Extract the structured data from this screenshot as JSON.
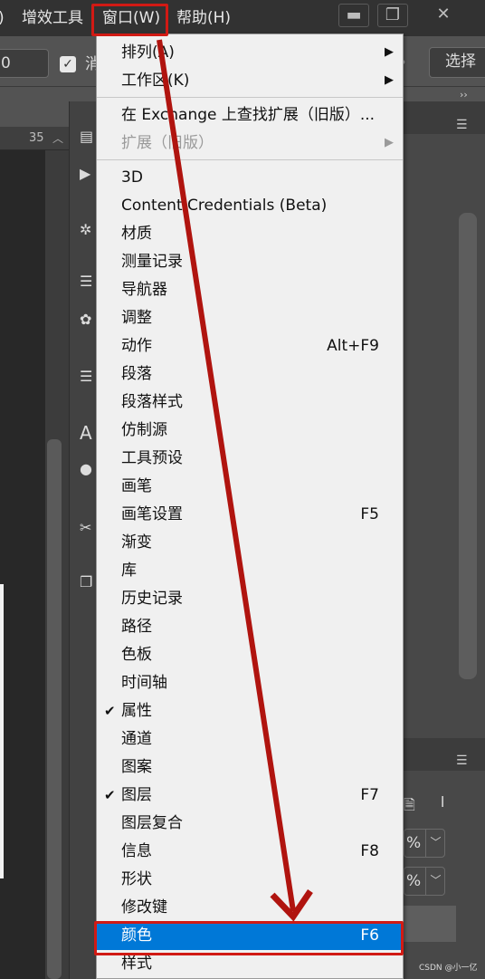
{
  "menubar": {
    "items": [
      {
        "label": ")"
      },
      {
        "label": "增效工具"
      },
      {
        "label": "窗口(W)"
      },
      {
        "label": "帮助(H)"
      }
    ],
    "window_controls": [
      "▬",
      "❐",
      "✕"
    ]
  },
  "options_bar": {
    "field_value": "0",
    "checkbox_label": "消",
    "select_button": "选择"
  },
  "ruler": {
    "value": "35"
  },
  "panel_labels": {
    "percent_1": "%",
    "percent_2": "%"
  },
  "menu": {
    "groups": [
      [
        {
          "label": "排列(A)",
          "submenu": true
        },
        {
          "label": "工作区(K)",
          "submenu": true
        }
      ],
      [
        {
          "label": "在 Exchange 上查找扩展（旧版）..."
        },
        {
          "label": "扩展（旧版）",
          "submenu": true,
          "disabled": true
        }
      ],
      [
        {
          "label": "3D"
        },
        {
          "label": "Content Credentials (Beta)"
        },
        {
          "label": "材质"
        },
        {
          "label": "测量记录"
        },
        {
          "label": "导航器"
        },
        {
          "label": "调整"
        },
        {
          "label": "动作",
          "shortcut": "Alt+F9"
        },
        {
          "label": "段落"
        },
        {
          "label": "段落样式"
        },
        {
          "label": "仿制源"
        },
        {
          "label": "工具预设"
        },
        {
          "label": "画笔"
        },
        {
          "label": "画笔设置",
          "shortcut": "F5"
        },
        {
          "label": "渐变"
        },
        {
          "label": "库"
        },
        {
          "label": "历史记录"
        },
        {
          "label": "路径"
        },
        {
          "label": "色板"
        },
        {
          "label": "时间轴"
        },
        {
          "label": "属性",
          "checked": true
        },
        {
          "label": "通道"
        },
        {
          "label": "图案"
        },
        {
          "label": "图层",
          "checked": true,
          "shortcut": "F7"
        },
        {
          "label": "图层复合"
        },
        {
          "label": "信息",
          "shortcut": "F8"
        },
        {
          "label": "形状"
        },
        {
          "label": "修改键"
        },
        {
          "label": "颜色",
          "shortcut": "F6",
          "highlighted": true
        },
        {
          "label": "样式"
        }
      ]
    ]
  },
  "colors": {
    "highlight": "#0078d7",
    "annotation_red": "#d11a14"
  },
  "watermark": "CSDN @小一亿"
}
